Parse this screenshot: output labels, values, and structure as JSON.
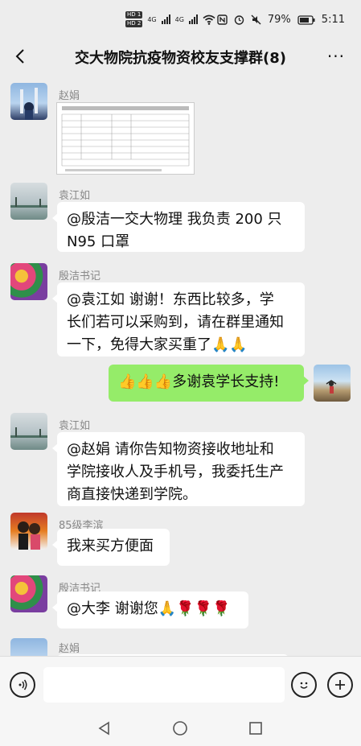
{
  "status_bar": {
    "hd1": "HD 1",
    "hd2": "HD 2",
    "net1": "4G",
    "net2": "4G",
    "battery": "79%",
    "time": "5:11"
  },
  "header": {
    "title": "交大物院抗疫物资校友支撑群(8)",
    "more": "···"
  },
  "messages": [
    {
      "sender": "赵娟",
      "type": "image",
      "content": ""
    },
    {
      "sender": "袁江如",
      "type": "text",
      "lines": [
        "@殷洁一交大物理  我负责 200 只",
        "N95 口罩"
      ]
    },
    {
      "sender": "殷洁书记",
      "type": "text",
      "lines": [
        "@袁江如  谢谢！东西比较多，学",
        "长们若可以采购到，请在群里通知",
        "一下，免得大家买重了🙏🙏"
      ]
    },
    {
      "sender": "",
      "type": "self",
      "lines": [
        "👍👍👍多谢袁学长支持!"
      ]
    },
    {
      "sender": "袁江如",
      "type": "text",
      "lines": [
        "@赵娟  请你告知物资接收地址和",
        "学院接收人及手机号，我委托生产",
        "商直接快递到学院。"
      ]
    },
    {
      "sender": "85级李滨",
      "type": "text",
      "lines": [
        "我来买方便面"
      ]
    },
    {
      "sender": "殷洁书记",
      "type": "text",
      "lines": [
        "@大李  谢谢您🙏🌹🌹🌹"
      ]
    },
    {
      "sender": "赵娟",
      "type": "partial",
      "lines": [
        ""
      ]
    }
  ],
  "colors": {
    "background": "#ededed",
    "self_bubble": "#95ec69",
    "other_bubble": "#ffffff"
  },
  "icons": {
    "back": "chevron-left-icon",
    "more": "more-dots-icon",
    "voice": "voice-icon",
    "emoji": "emoji-face-icon",
    "plus": "plus-icon",
    "nav_back": "triangle-back-icon",
    "nav_home": "circle-home-icon",
    "nav_recent": "square-recent-icon"
  }
}
